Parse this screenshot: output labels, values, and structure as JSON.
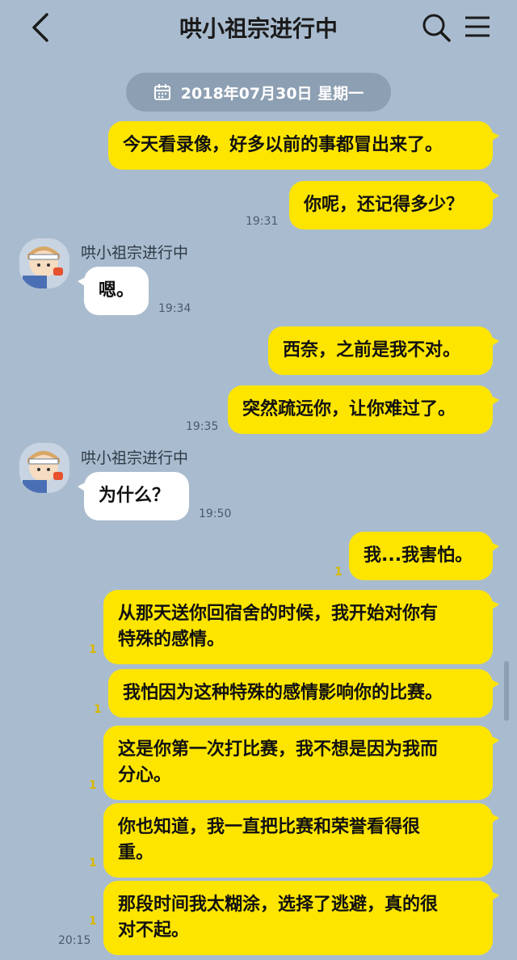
{
  "header": {
    "title": "哄小祖宗进行中"
  },
  "date_divider": "2018年07月30日 星期一",
  "messages": [
    {
      "text": "今天看录像，好多以前的事都冒出来了。"
    },
    {
      "text": "你呢，还记得多少？",
      "time": "19:31"
    },
    {
      "sender": "哄小祖宗进行中",
      "text": "嗯。",
      "time": "19:34"
    },
    {
      "text": "西奈，之前是我不对。"
    },
    {
      "text": "突然疏远你，让你难过了。",
      "time": "19:35"
    },
    {
      "sender": "哄小祖宗进行中",
      "text": "为什么？",
      "time": "19:50"
    },
    {
      "text": "我...我害怕。",
      "unread": "1"
    },
    {
      "line1": "从那天送你回宿舍的时候，我开始对你有",
      "line2": "特殊的感情。",
      "unread": "1"
    },
    {
      "text": "我怕因为这种特殊的感情影响你的比赛。",
      "unread": "1"
    },
    {
      "line1": "这是你第一次打比赛，我不想是因为我而",
      "line2": "分心。",
      "unread": "1"
    },
    {
      "line1": "你也知道，我一直把比赛和荣誉看得很",
      "line2": "重。",
      "unread": "1"
    },
    {
      "line1": "那段时间我太糊涂，选择了逃避，真的很",
      "line2": "对不起。",
      "unread": "1",
      "time": "20:15"
    }
  ],
  "colors": {
    "background": "#a9bccf",
    "my_bubble": "#fee500",
    "their_bubble": "#ffffff"
  }
}
